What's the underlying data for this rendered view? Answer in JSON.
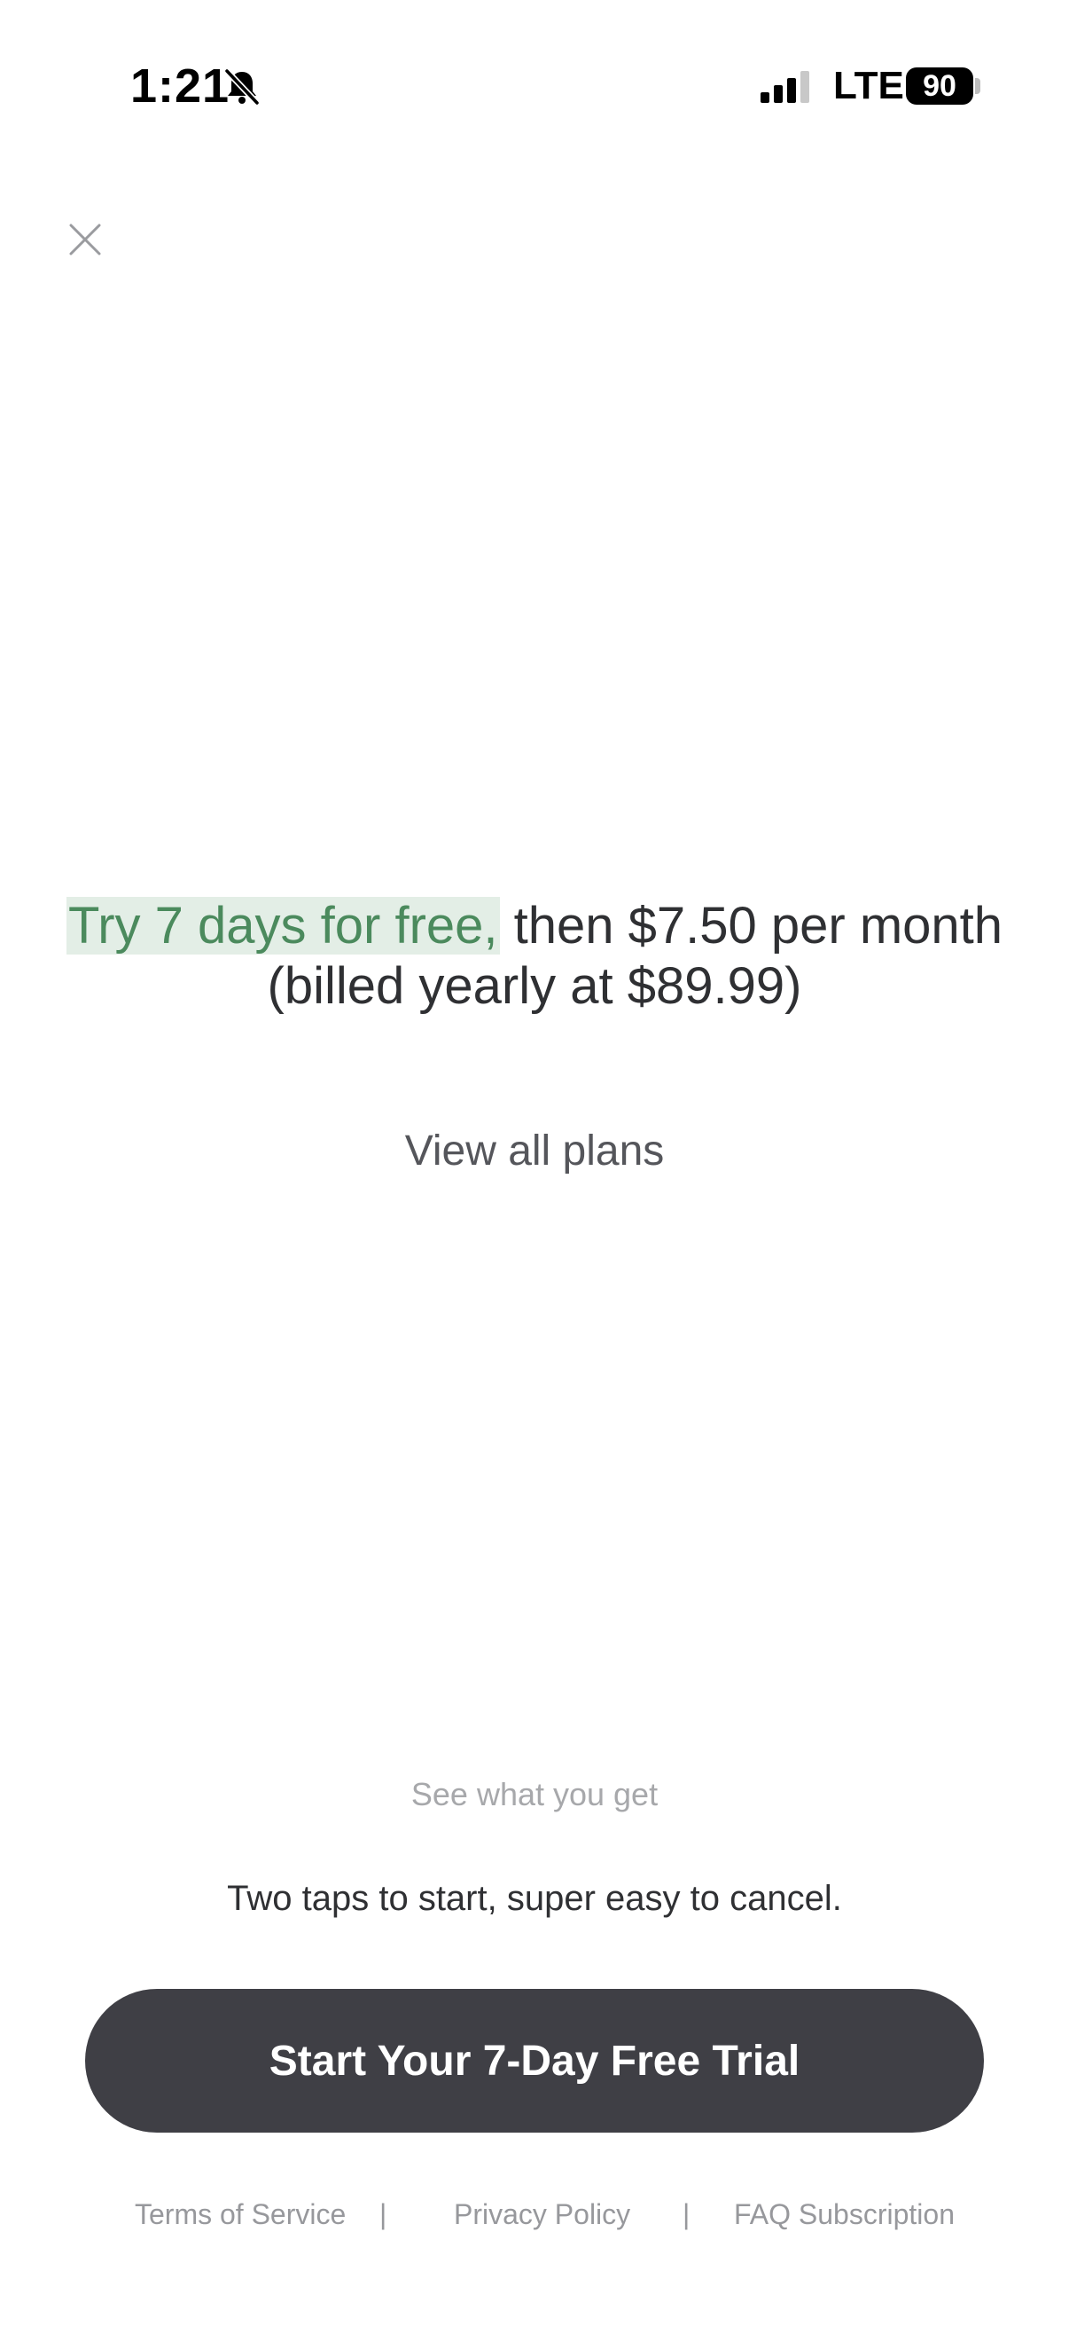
{
  "status_bar": {
    "time": "1:21",
    "network": "LTE",
    "battery": "90",
    "icons": [
      "bell-slash-icon",
      "signal-icon",
      "battery-icon"
    ]
  },
  "close_icon": "close-icon",
  "offer": {
    "highlight": "Try 7 days for free,",
    "rest_line1": " then $7.50 per month",
    "line2": "(billed yearly at $89.99)",
    "highlight_bg": "#e3eee6",
    "highlight_color": "#4b8a5d"
  },
  "view_all_plans": "View all plans",
  "see_what_you_get": "See what you get",
  "cancel_note": "Two taps to start, super easy to cancel.",
  "cta": {
    "label": "Start Your 7-Day Free Trial",
    "bg": "#3f3f45"
  },
  "footer": {
    "terms": "Terms of Service",
    "separator": "|",
    "privacy": "Privacy Policy",
    "faq": "FAQ Subscription"
  }
}
